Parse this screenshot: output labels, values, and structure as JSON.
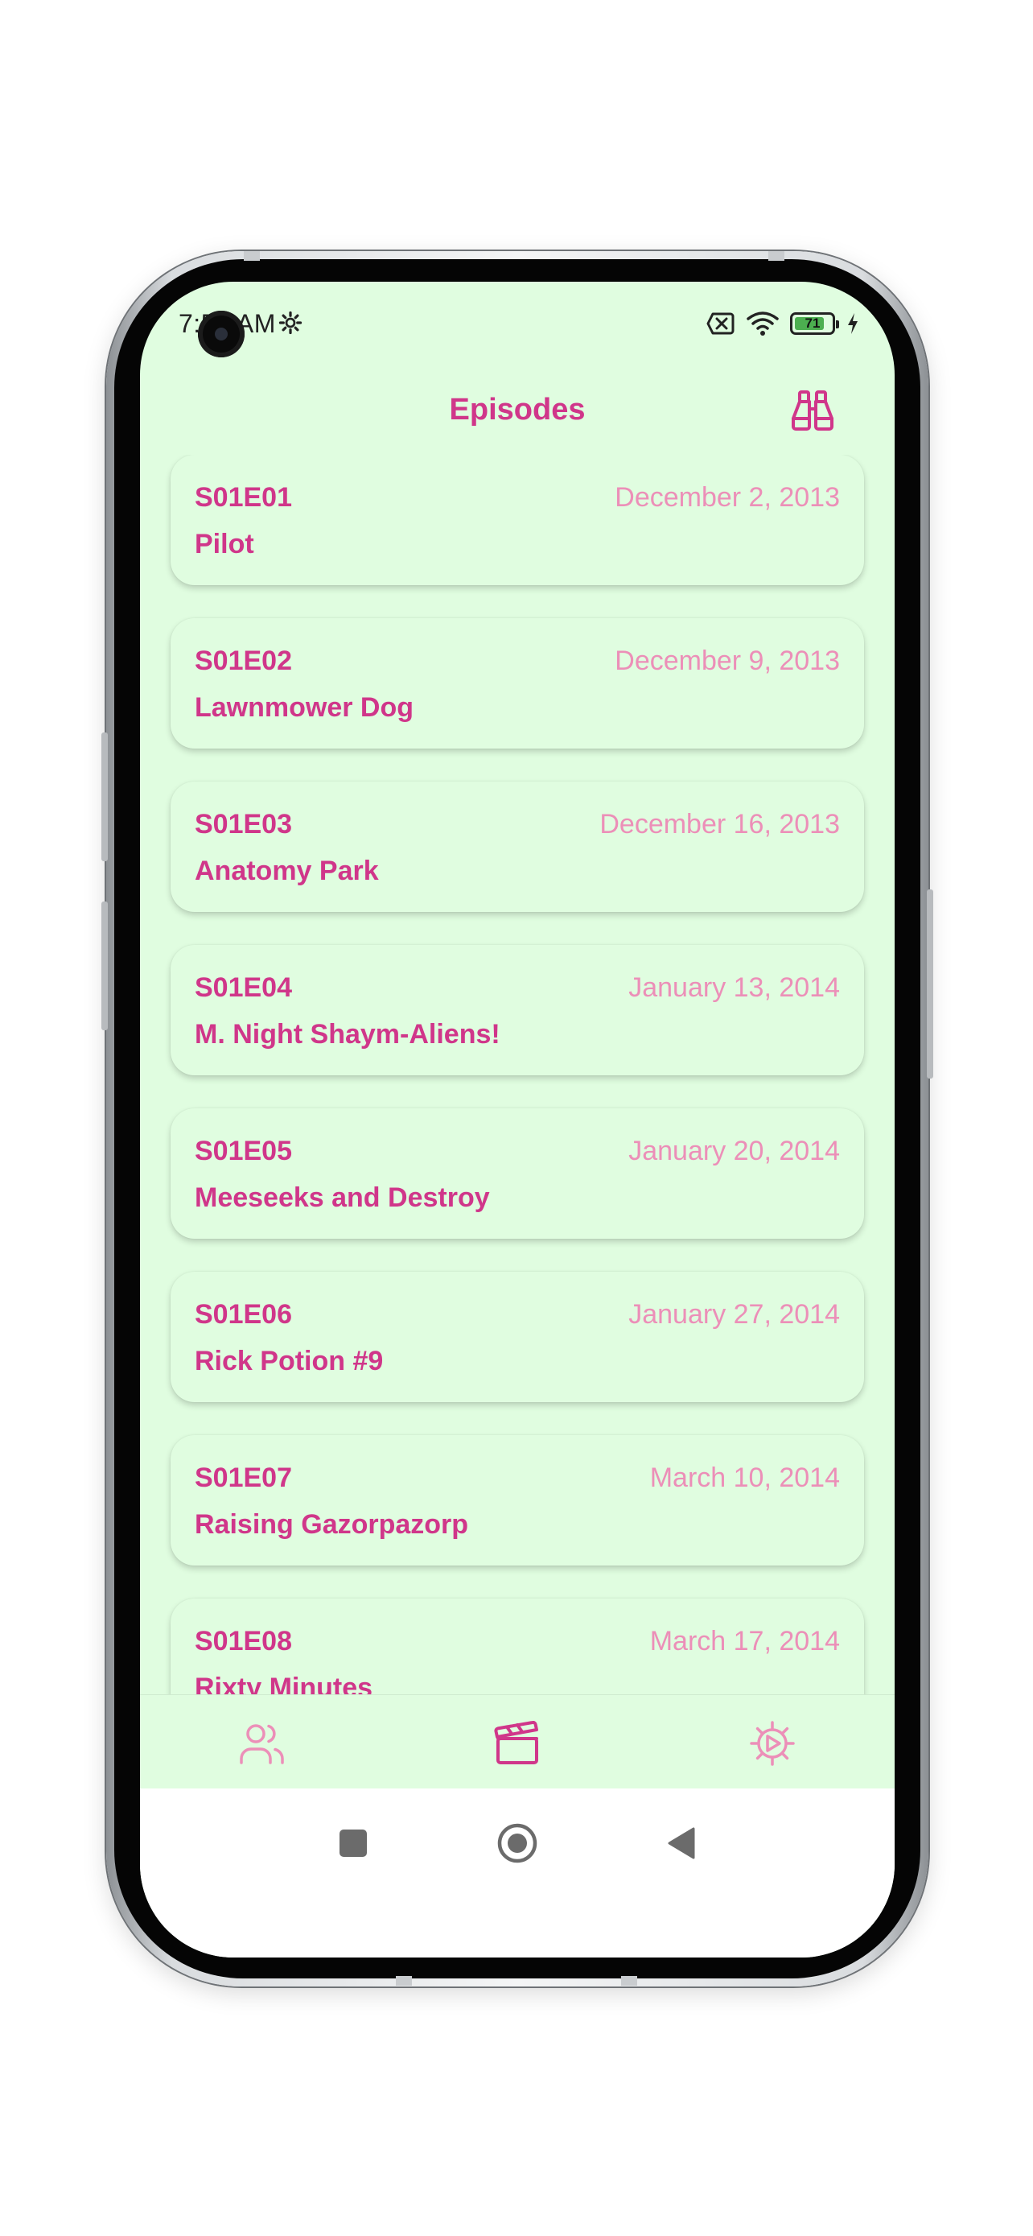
{
  "status_bar": {
    "time": "7:51 AM",
    "battery_level": "71"
  },
  "header": {
    "title": "Episodes"
  },
  "episodes": [
    {
      "code": "S01E01",
      "date": "December 2, 2013",
      "name": "Pilot"
    },
    {
      "code": "S01E02",
      "date": "December 9, 2013",
      "name": "Lawnmower Dog"
    },
    {
      "code": "S01E03",
      "date": "December 16, 2013",
      "name": "Anatomy Park"
    },
    {
      "code": "S01E04",
      "date": "January 13, 2014",
      "name": "M. Night Shaym-Aliens!"
    },
    {
      "code": "S01E05",
      "date": "January 20, 2014",
      "name": "Meeseeks and Destroy"
    },
    {
      "code": "S01E06",
      "date": "January 27, 2014",
      "name": "Rick Potion #9"
    },
    {
      "code": "S01E07",
      "date": "March 10, 2014",
      "name": "Raising Gazorpazorp"
    },
    {
      "code": "S01E08",
      "date": "March 17, 2014",
      "name": "Rixty Minutes"
    }
  ],
  "bottom_nav": {
    "items": [
      {
        "icon": "users-icon",
        "active": false
      },
      {
        "icon": "clapperboard-icon",
        "active": true
      },
      {
        "icon": "settings-icon",
        "active": false
      }
    ]
  },
  "colors": {
    "background": "#e0fde0",
    "primary": "#d0368a",
    "secondary": "#ec8fb8"
  }
}
